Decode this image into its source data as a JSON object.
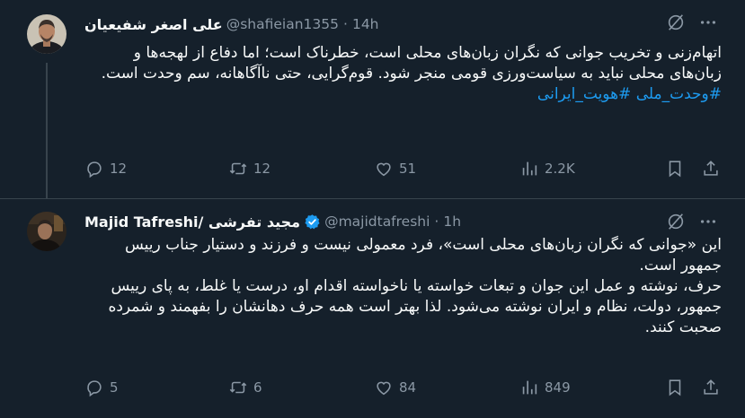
{
  "tweets": [
    {
      "author_name": "علی اصغر شفیعیان",
      "handle": "@shafieian1355",
      "separator": "·",
      "time": "14h",
      "text": "اتهام‌زنی و تخریب جوانی که نگران زبان‌های محلی است، خطرناک است؛ اما دفاع از لهجه‌ها و زبان‌های محلی نباید به سیاست‌ورزی قومی منجر شود. قوم‌گرایی، حتی ناآگاهانه، سم وحدت است.",
      "hashtags": "#وحدت_ملی #هویت_ایرانی",
      "counts": {
        "replies": "12",
        "reposts": "12",
        "likes": "51",
        "views": "2.2K"
      }
    },
    {
      "author_name": "Majid Tafreshi/ مجید تفرشی",
      "handle": "@majidtafreshi",
      "separator": "·",
      "time": "1h",
      "verified": true,
      "text_p1": "این «جوانی که نگران زبان‌های محلی است»، فرد معمولی نیست و فرزند و دستیار جناب رییس جمهور است.",
      "text_p2": "حرف، نوشته و عمل این جوان و تبعات خواسته یا ناخواسته اقدام او، درست یا غلط، به پای رییس جمهور، دولت، نظام و ایران نوشته می‌شود. لذا بهتر است همه حرف دهانشان را بفهمند و شمرده صحبت کنند.",
      "counts": {
        "replies": "5",
        "reposts": "6",
        "likes": "84",
        "views": "849"
      }
    }
  ],
  "colors": {
    "background": "#15202b",
    "divider": "#38444d",
    "text": "#f7f9f9",
    "muted": "#8b98a5",
    "link": "#1d9bf0"
  },
  "icons": [
    "grok-icon",
    "more-icon",
    "reply-icon",
    "repost-icon",
    "like-icon",
    "views-icon",
    "bookmark-icon",
    "share-icon",
    "verified-badge-icon"
  ]
}
